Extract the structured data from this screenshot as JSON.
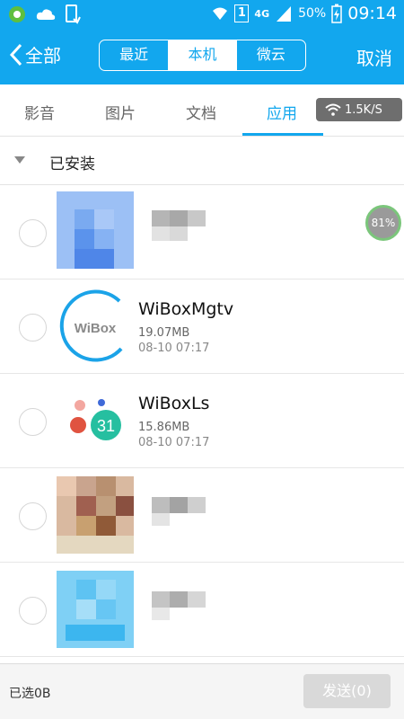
{
  "status_bar": {
    "battery_percent": "50%",
    "time": "09:14",
    "sim_badge": "1",
    "network": "4G"
  },
  "nav": {
    "back_label": "全部",
    "segments": [
      "最近",
      "本机",
      "微云"
    ],
    "active_segment": 1,
    "cancel_label": "取消"
  },
  "tabs": {
    "items": [
      "影音",
      "图片",
      "文档",
      "应用"
    ],
    "active": 3,
    "speed_label": "1.5K/S"
  },
  "group": {
    "label": "已安装"
  },
  "apps": [
    {
      "name": "",
      "size": "",
      "date": "",
      "progress": "81%"
    },
    {
      "name": "WiBoxMgtv",
      "size": "19.07MB",
      "date": "08-10 07:17",
      "icon_text": "WiBox"
    },
    {
      "name": "WiBoxLs",
      "size": "15.86MB",
      "date": "08-10 07:17",
      "icon_text": "31"
    },
    {
      "name": "",
      "size": "",
      "date": ""
    },
    {
      "name": "",
      "size": "",
      "date": ""
    }
  ],
  "bottom": {
    "selected_label": "已选0B",
    "send_label": "发送(0)"
  },
  "colors": {
    "accent": "#12a7ee",
    "progress_ring": "#7bc67b",
    "send_disabled": "#d9d9d9"
  }
}
